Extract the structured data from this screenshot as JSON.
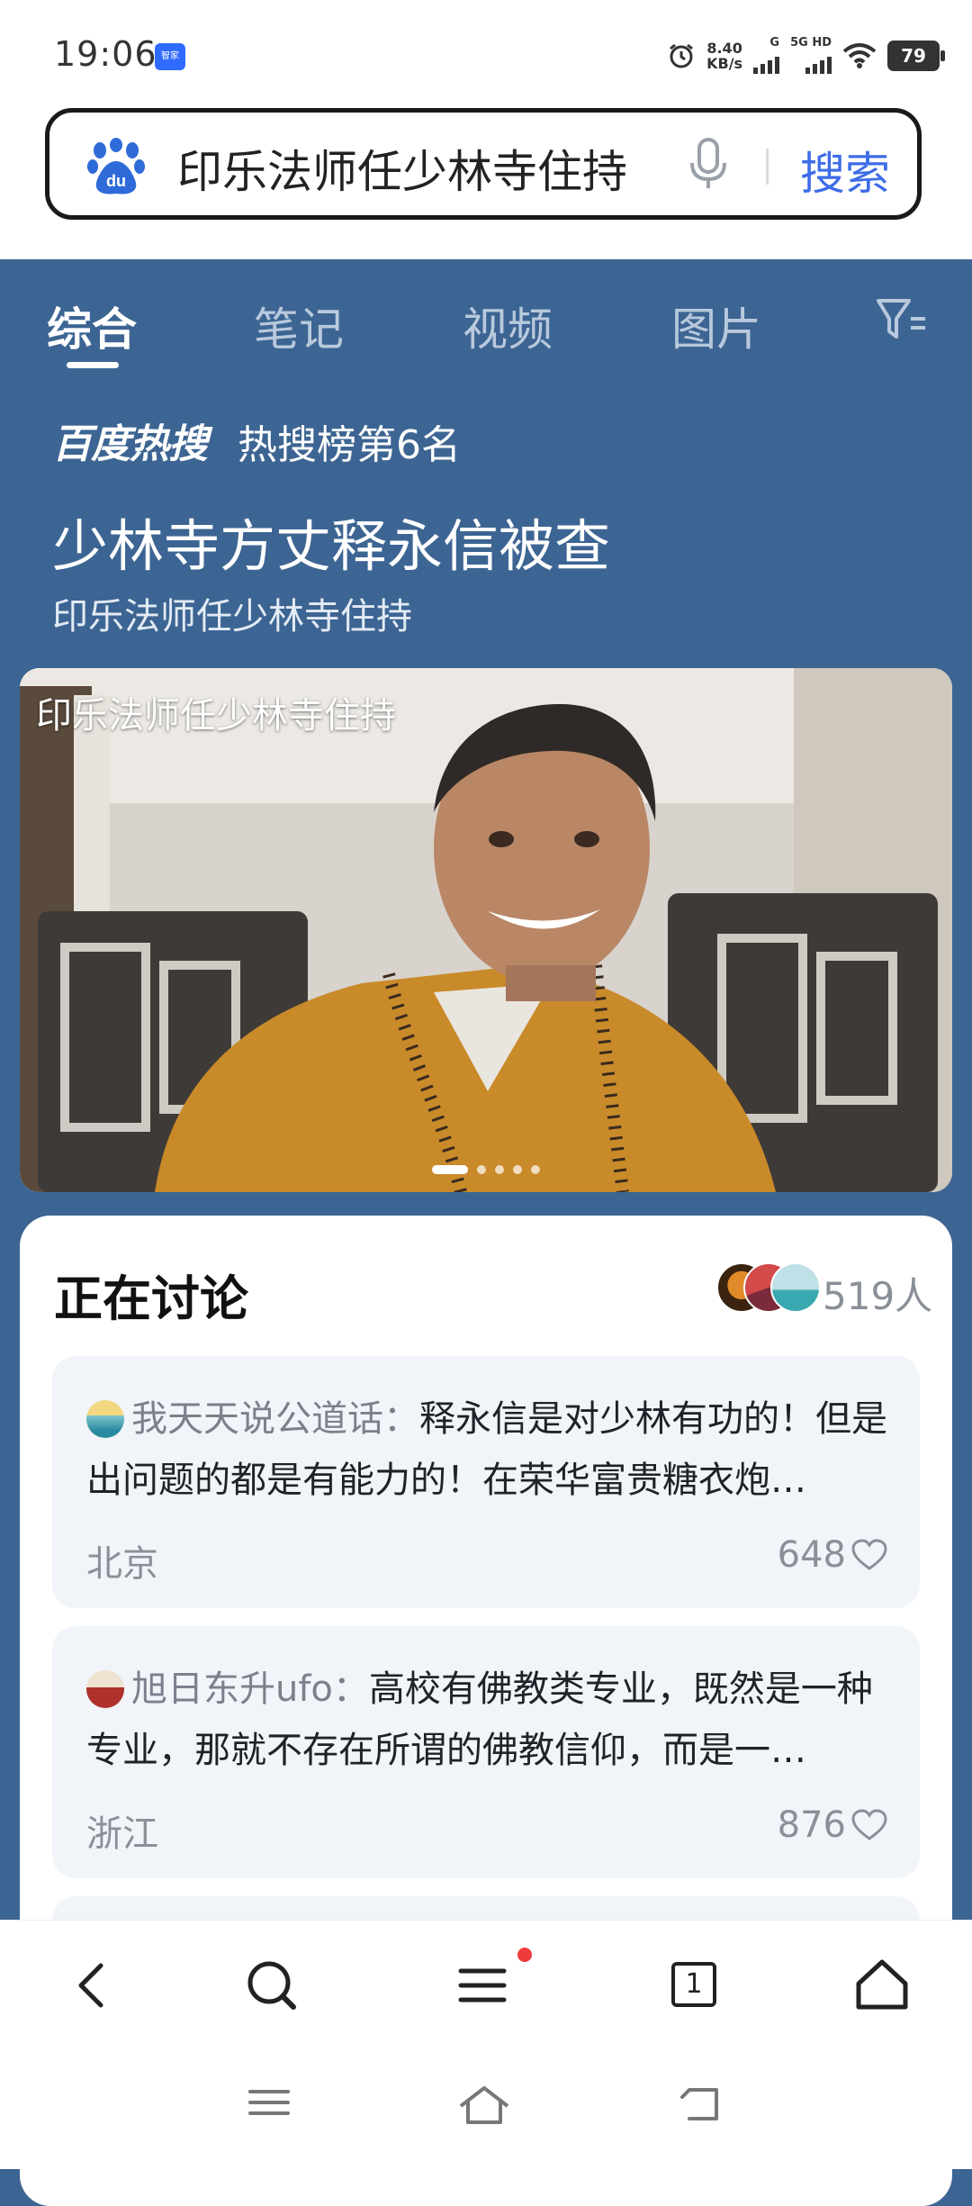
{
  "status_bar": {
    "time": "19:06",
    "app_badge": "智家",
    "net_speed": "8.40",
    "net_unit": "KB/s",
    "net_g": "G",
    "net_5g": "5G HD",
    "battery": "79"
  },
  "search": {
    "query": "印乐法师任少林寺住持",
    "button": "搜索"
  },
  "tabs": [
    "综合",
    "笔记",
    "视频",
    "图片"
  ],
  "hot": {
    "brand": "百度热搜",
    "rank": "热搜榜第6名",
    "headline": "少林寺方丈释永信被查",
    "subhead": "印乐法师任少林寺住持"
  },
  "photo": {
    "caption": "印乐法师任少林寺住持",
    "dots": 5,
    "active_dot": 0
  },
  "discussion": {
    "title": "正在讨论",
    "count": "519人",
    "comments": [
      {
        "user": "我天天说公道话：",
        "text": "释永信是对少林有功的！但是出问题的都是有能力的！在荣华富贵糖衣炮…",
        "location": "北京",
        "likes": "648"
      },
      {
        "user": "旭日东升ufo：",
        "text": "高校有佛教类专业，既然是一种专业，那就不存在所谓的佛教信仰，而是一…",
        "location": "浙江",
        "likes": "876"
      }
    ]
  },
  "bottom_nav": {
    "tabs_count": "1"
  },
  "colors": {
    "page_bg": "#3d6593",
    "search_button": "#3d6ce8",
    "card_bg": "#ffffff",
    "comment_bg": "#f1f4f8"
  }
}
